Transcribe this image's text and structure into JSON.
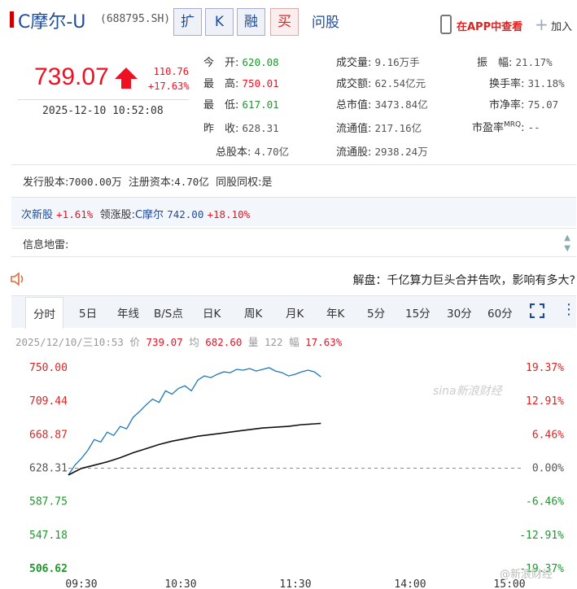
{
  "header": {
    "name": "C摩尔-U",
    "code": "(688795.SH)",
    "tags": [
      "扩",
      "K",
      "融",
      "买"
    ],
    "ask": "问股",
    "app_link": "在APP中查看",
    "add": "加入"
  },
  "quote": {
    "price": "739.07",
    "change": "110.76",
    "change_pct": "+17.63%",
    "time": "2025-12-10 10:52:08"
  },
  "stats": {
    "open": {
      "label": "今　开:",
      "value": "620.08"
    },
    "high": {
      "label": "最　高:",
      "value": "750.01"
    },
    "low": {
      "label": "最　低:",
      "value": "617.01"
    },
    "prev_close": {
      "label": "昨　收:",
      "value": "628.31"
    },
    "total_shares": {
      "label": "总股本:",
      "value": "4.70亿"
    },
    "volume": {
      "label": "成交量:",
      "value": "9.16万手"
    },
    "turnover": {
      "label": "成交额:",
      "value": "62.54亿元"
    },
    "market_cap": {
      "label": "总市值:",
      "value": "3473.84亿"
    },
    "float_cap": {
      "label": "流通值:",
      "value": "217.16亿"
    },
    "float_shares": {
      "label": "流通股:",
      "value": "2938.24万"
    },
    "amplitude": {
      "label": "振　幅:",
      "value": "21.17%"
    },
    "turnover_rate": {
      "label": "换手率:",
      "value": "31.18%"
    },
    "pb": {
      "label": "市净率:",
      "value": "75.07"
    },
    "pe": {
      "label": "市盈率",
      "sup": "MRQ",
      "value": "--"
    }
  },
  "info": {
    "issue_shares": "发行股本:",
    "issue_shares_val": "7000.00万",
    "reg_capital": "注册资本:",
    "reg_capital_val": "4.70亿",
    "same_rights": "同股同权:是",
    "sector": "次新股",
    "sector_pct": "+1.61%",
    "leader_label": "领涨股:",
    "leader": "C摩尔",
    "leader_price": "742.00",
    "leader_pct": "+18.10%",
    "mine": "信息地雷:"
  },
  "news": "解盘：千亿算力巨头合并告吹，影响有多大?",
  "tabs": [
    "分时",
    "5日",
    "年线",
    "B/S点",
    "日K",
    "周K",
    "月K",
    "年K",
    "5分",
    "15分",
    "30分",
    "60分"
  ],
  "meta": {
    "date": "2025/12/10/三10:53",
    "price_label": "价",
    "price": "739.07",
    "avg_label": "均",
    "avg": "682.60",
    "vol_label": "量",
    "vol": "122",
    "amp_label": "幅",
    "amp": "17.63%"
  },
  "watermark": "sina新浪财经",
  "watermark2": "@新浪财经",
  "chart_data": {
    "type": "line",
    "y_left_ticks": [
      "750.00",
      "709.44",
      "668.87",
      "628.31",
      "587.75",
      "547.18",
      "506.62"
    ],
    "y_right_ticks": [
      "19.37%",
      "12.91%",
      "6.46%",
      "0.00%",
      "-6.46%",
      "-12.91%",
      "-19.37%"
    ],
    "x_ticks": [
      "09:30",
      "10:30",
      "11:30",
      "14:00",
      "15:00"
    ],
    "ylim": [
      506.62,
      750.0
    ],
    "prev_close": 628.31,
    "colors": {
      "price": "#1f77b4",
      "avg": "#111111",
      "up": "#e12222",
      "down": "#1a9a2a",
      "flat": "#888888"
    },
    "series": [
      {
        "x": [
          0,
          5,
          10,
          15,
          20,
          25,
          30,
          35,
          40,
          45,
          50,
          55,
          60,
          65,
          70,
          75,
          80,
          85,
          90,
          95,
          100,
          105,
          110,
          115,
          120,
          125,
          130,
          135,
          140,
          145,
          150,
          155,
          160,
          165,
          170,
          175,
          180,
          185,
          190,
          195
        ],
        "values": [
          620,
          632,
          640,
          650,
          663,
          660,
          672,
          668,
          679,
          676,
          690,
          697,
          705,
          712,
          708,
          722,
          718,
          725,
          728,
          722,
          735,
          740,
          738,
          742,
          745,
          744,
          748,
          747,
          749,
          746,
          748,
          750,
          746,
          744,
          740,
          742,
          745,
          747,
          745,
          739
        ]
      },
      {
        "x": [
          0,
          10,
          20,
          30,
          40,
          50,
          60,
          70,
          80,
          90,
          100,
          110,
          120,
          130,
          140,
          150,
          160,
          170,
          180,
          190,
          195
        ],
        "values": [
          620,
          628,
          632,
          636,
          641,
          647,
          652,
          657,
          661,
          664,
          667,
          669,
          671,
          673,
          675,
          677,
          678,
          679,
          681,
          682,
          682.6
        ]
      }
    ]
  }
}
